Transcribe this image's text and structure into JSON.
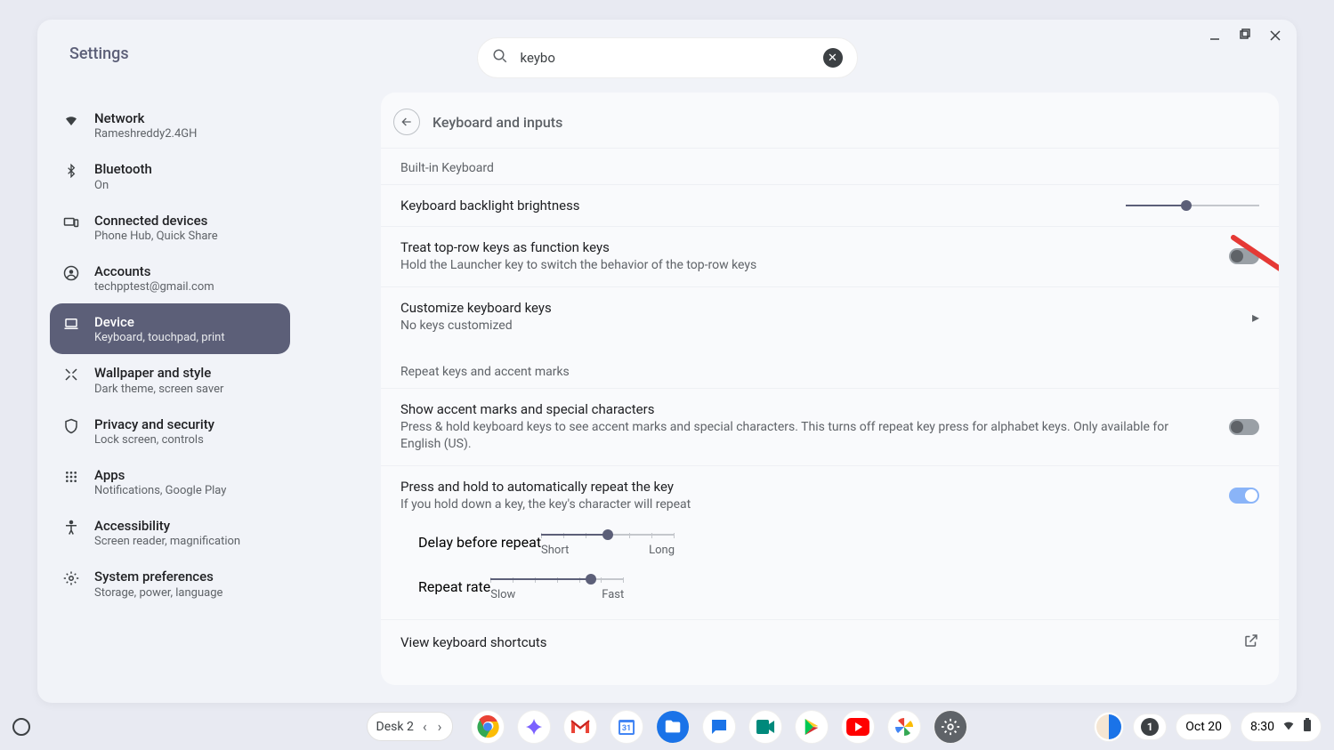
{
  "app_title": "Settings",
  "search": {
    "value": "keybo"
  },
  "sidebar": [
    {
      "icon": "wifi",
      "title": "Network",
      "sub": "Rameshreddy2.4GH"
    },
    {
      "icon": "bluetooth",
      "title": "Bluetooth",
      "sub": "On"
    },
    {
      "icon": "devices",
      "title": "Connected devices",
      "sub": "Phone Hub, Quick Share"
    },
    {
      "icon": "account",
      "title": "Accounts",
      "sub": "techpptest@gmail.com"
    },
    {
      "icon": "laptop",
      "title": "Device",
      "sub": "Keyboard, touchpad, print",
      "active": true
    },
    {
      "icon": "wallpaper",
      "title": "Wallpaper and style",
      "sub": "Dark theme, screen saver"
    },
    {
      "icon": "shield",
      "title": "Privacy and security",
      "sub": "Lock screen, controls"
    },
    {
      "icon": "apps",
      "title": "Apps",
      "sub": "Notifications, Google Play"
    },
    {
      "icon": "a11y",
      "title": "Accessibility",
      "sub": "Screen reader, magnification"
    },
    {
      "icon": "gear",
      "title": "System preferences",
      "sub": "Storage, power, language"
    }
  ],
  "page": {
    "title": "Keyboard and inputs",
    "section1": "Built-in Keyboard",
    "backlight": {
      "label": "Keyboard backlight brightness",
      "pct": 45
    },
    "fn": {
      "title": "Treat top-row keys as function keys",
      "sub": "Hold the Launcher key to switch the behavior of the top-row keys",
      "on": false
    },
    "custom": {
      "title": "Customize keyboard keys",
      "sub": "No keys customized"
    },
    "section2": "Repeat keys and accent marks",
    "accent": {
      "title": "Show accent marks and special characters",
      "sub": "Press & hold keyboard keys to see accent marks and special characters. This turns off repeat key press for alphabet keys. Only available for English (US).",
      "on": false
    },
    "repeat": {
      "title": "Press and hold to automatically repeat the key",
      "sub": "If you hold down a key, the key's character will repeat",
      "on": true
    },
    "delay": {
      "label": "Delay before repeat",
      "lo": "Short",
      "hi": "Long",
      "pct": 50
    },
    "rate": {
      "label": "Repeat rate",
      "lo": "Slow",
      "hi": "Fast",
      "pct": 75
    },
    "shortcuts": "View keyboard shortcuts"
  },
  "shelf": {
    "desk": "Desk 2",
    "date": "Oct 20",
    "time": "8:30",
    "notif": "1"
  }
}
